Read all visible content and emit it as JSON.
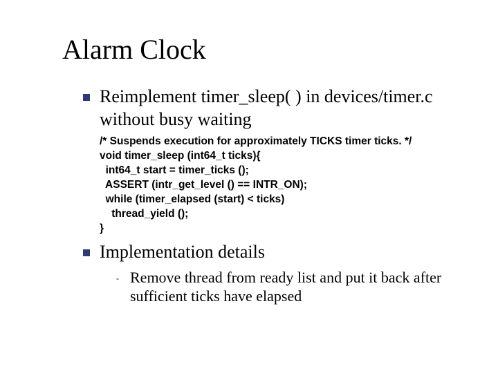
{
  "title": "Alarm Clock",
  "bullets": {
    "reimplement": "Reimplement timer_sleep( ) in devices/timer.c without busy waiting",
    "impl_details": "Implementation details"
  },
  "code": "/* Suspends execution for approximately TICKS timer ticks. */\nvoid timer_sleep (int64_t ticks){\n  int64_t start = timer_ticks ();\n  ASSERT (intr_get_level () == INTR_ON);\n  while (timer_elapsed (start) < ticks)\n    thread_yield ();\n}",
  "sub": {
    "dash": "-",
    "remove_thread": "Remove thread from ready list and put it back after sufficient ticks have elapsed"
  }
}
